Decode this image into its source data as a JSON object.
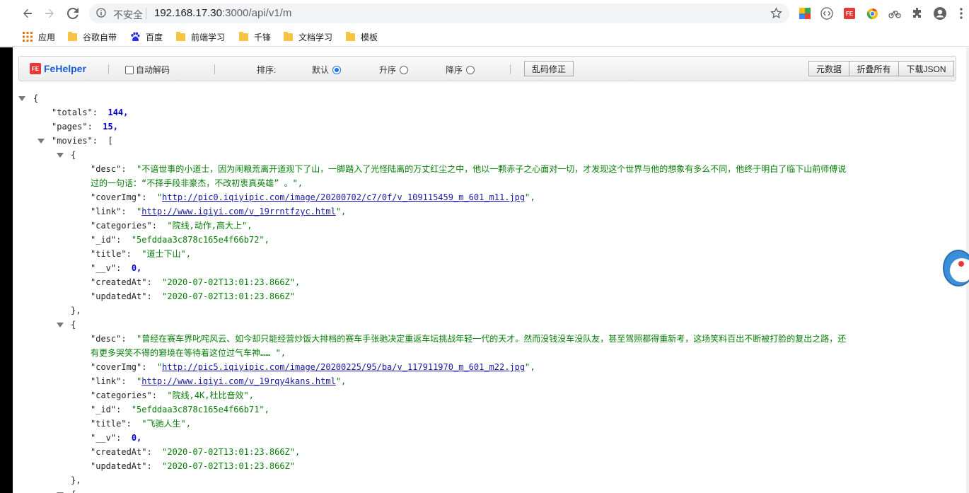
{
  "browser": {
    "insecure_label": "不安全",
    "url_host": "192.168.17.30",
    "url_path": ":3000/api/v1/m"
  },
  "bookmarks": [
    {
      "label": "应用",
      "icon": "apps-grid-icon"
    },
    {
      "label": "谷歌自带",
      "icon": "folder-icon"
    },
    {
      "label": "百度",
      "icon": "paw-icon"
    },
    {
      "label": "前端学习",
      "icon": "folder-icon"
    },
    {
      "label": "千锋",
      "icon": "folder-icon"
    },
    {
      "label": "文档学习",
      "icon": "folder-icon"
    },
    {
      "label": "模板",
      "icon": "folder-icon"
    }
  ],
  "fehelper": {
    "logo": "FeHelper",
    "badge": "FE",
    "auto_decode": "自动解码",
    "sort_label": "排序:",
    "sort_default": "默认",
    "sort_asc": "升序",
    "sort_desc": "降序",
    "fix_garbled": "乱码修正",
    "metadata": "元数据",
    "fold_all": "折叠所有",
    "download_json": "下载JSON"
  },
  "json": {
    "open_brace": "{",
    "totals_key": "\"totals\":",
    "totals_val": "144,",
    "pages_key": "\"pages\":",
    "pages_val": "15,",
    "movies_key": "\"movies\":",
    "movies_open": "[",
    "movies": [
      {
        "open": "{",
        "desc_key": "\"desc\":",
        "desc_line1": "\"不谙世事的小道士，因为闹粮荒离开道观下了山，一脚踏入了光怪陆离的万丈红尘之中，他以一颗赤子之心面对一切，才发现这个世界与他的想象有多么不同，他终于明白了临下山前师傅说",
        "desc_line2": "过的一句话：“不择手段非豪杰，不改初衷真英雄” 。\",",
        "cover_key": "\"coverImg\":",
        "cover_val": "http://pic0.iqiyipic.com/image/20200702/c7/0f/v_109115459_m_601_m11.jpg",
        "link_key": "\"link\":",
        "link_val": "http://www.iqiyi.com/v_19rrntfzyc.html",
        "cat_key": "\"categories\":",
        "cat_val": "\"院线,动作,高大上\",",
        "id_key": "\"_id\":",
        "id_val": "\"5efddaa3c878c165e4f66b72\",",
        "title_key": "\"title\":",
        "title_val": "\"道士下山\",",
        "v_key": "\"__v\":",
        "v_val": "0,",
        "created_key": "\"createdAt\":",
        "created_val": "\"2020-07-02T13:01:23.866Z\",",
        "updated_key": "\"updatedAt\":",
        "updated_val": "\"2020-07-02T13:01:23.866Z\"",
        "close": "},"
      },
      {
        "open": "{",
        "desc_key": "\"desc\":",
        "desc_line1": "\"曾经在赛车界叱咤风云、如今却只能经营炒饭大排档的赛车手张驰决定重返车坛挑战年轻一代的天才。然而没钱没车没队友，甚至驾照都得重新考，这场笑料百出不断被打脸的复出之路，还",
        "desc_line2": "有更多哭笑不得的窘境在等待着这位过气车神…… \",",
        "cover_key": "\"coverImg\":",
        "cover_val": "http://pic5.iqiyipic.com/image/20200225/95/ba/v_117911970_m_601_m22.jpg",
        "link_key": "\"link\":",
        "link_val": "http://www.iqiyi.com/v_19rqy4kans.html",
        "cat_key": "\"categories\":",
        "cat_val": "\"院线,4K,杜比音效\",",
        "id_key": "\"_id\":",
        "id_val": "\"5efddaa3c878c165e4f66b71\",",
        "title_key": "\"title\":",
        "title_val": "\"飞驰人生\",",
        "v_key": "\"__v\":",
        "v_val": "0,",
        "created_key": "\"createdAt\":",
        "created_val": "\"2020-07-02T13:01:23.866Z\",",
        "updated_key": "\"updatedAt\":",
        "updated_val": "\"2020-07-02T13:01:23.866Z\"",
        "close": "},"
      }
    ],
    "third_open": "{"
  }
}
